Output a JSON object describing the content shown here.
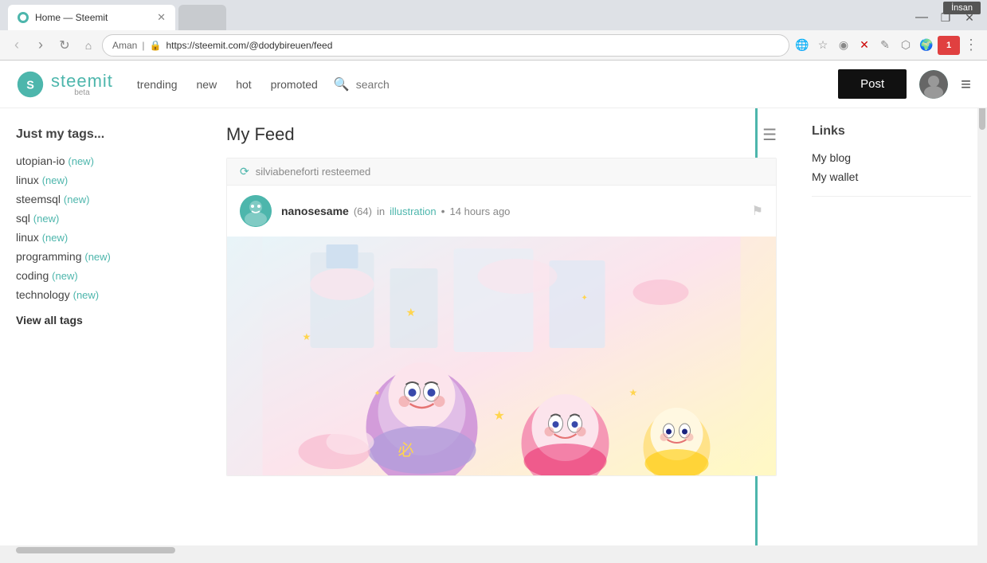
{
  "browser": {
    "profile_label": "İnsan",
    "tab_title": "Home — Steemit",
    "tab_favicon_alt": "steemit-favicon",
    "inactive_tab_label": "",
    "address_label": "Aman",
    "url": "https://steemit.com/@dodybireuen/feed",
    "window_minimize": "—",
    "window_restore": "❐",
    "window_close": "✕"
  },
  "navbar": {
    "logo_text": "steemit",
    "logo_beta": "beta",
    "nav_links": [
      {
        "label": "trending",
        "id": "trending"
      },
      {
        "label": "new",
        "id": "new"
      },
      {
        "label": "hot",
        "id": "hot"
      },
      {
        "label": "promoted",
        "id": "promoted"
      }
    ],
    "search_placeholder": "search",
    "post_button_label": "Post",
    "hamburger_icon": "≡"
  },
  "sidebar_left": {
    "title": "Just my tags...",
    "tags": [
      {
        "name": "utopian-io",
        "badge": "(new)"
      },
      {
        "name": "linux",
        "badge": "(new)"
      },
      {
        "name": "steemsql",
        "badge": "(new)"
      },
      {
        "name": "sql",
        "badge": "(new)"
      },
      {
        "name": "linux",
        "badge": "(new)"
      },
      {
        "name": "programming",
        "badge": "(new)"
      },
      {
        "name": "coding",
        "badge": "(new)"
      },
      {
        "name": "technology",
        "badge": "(new)"
      }
    ],
    "view_all_tags": "View all tags"
  },
  "feed": {
    "title": "My Feed",
    "menu_icon": "☰",
    "resteemed_by": "silviabeneforti resteemed",
    "post": {
      "author": "nanosesame",
      "reputation": "(64)",
      "in_label": "in",
      "category": "illustration",
      "time": "14 hours ago",
      "flag_icon": "⚑"
    }
  },
  "sidebar_right": {
    "title": "Links",
    "links": [
      {
        "label": "My blog",
        "id": "my-blog"
      },
      {
        "label": "My wallet",
        "id": "my-wallet"
      }
    ]
  },
  "colors": {
    "teal": "#4db6ac",
    "dark": "#111111",
    "light_bg": "#f5f5f5"
  }
}
